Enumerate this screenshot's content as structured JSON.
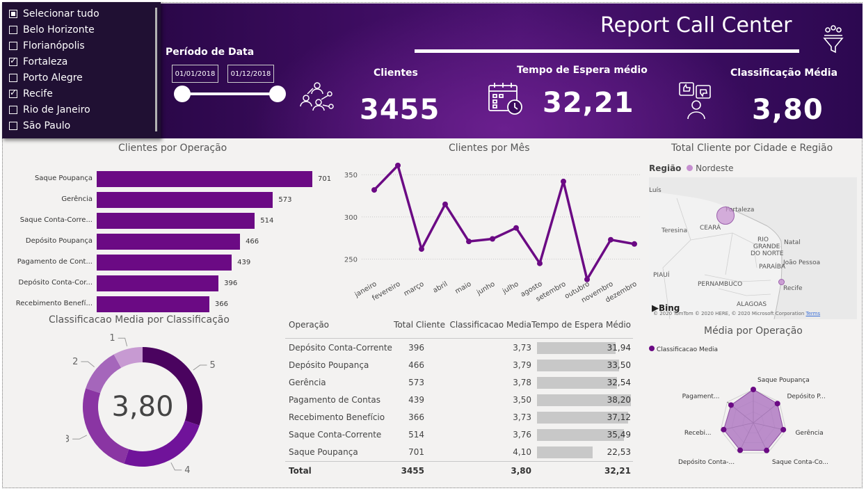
{
  "header": {
    "title": "Report Call Center",
    "periodo_label": "Período de Data",
    "date_start": "01/01/2018",
    "date_end": "01/12/2018",
    "kpis": [
      {
        "label": "Clientes",
        "value": "3455"
      },
      {
        "label": "Tempo de Espera médio",
        "value": "32,21"
      },
      {
        "label": "Classificação Média",
        "value": "3,80"
      }
    ]
  },
  "slicer": {
    "items": [
      {
        "label": "Selecionar tudo",
        "state": "partial"
      },
      {
        "label": "Belo Horizonte",
        "state": "unchecked"
      },
      {
        "label": "Florianópolis",
        "state": "unchecked"
      },
      {
        "label": "Fortaleza",
        "state": "checked"
      },
      {
        "label": "Porto Alegre",
        "state": "unchecked"
      },
      {
        "label": "Recife",
        "state": "checked"
      },
      {
        "label": "Rio de Janeiro",
        "state": "unchecked"
      },
      {
        "label": "São Paulo",
        "state": "unchecked"
      }
    ]
  },
  "colors": {
    "accent": "#6b0a84",
    "line": "#6b0a84",
    "map_bubble": "#c68fd0",
    "radar_fill": "#b07bc3"
  },
  "chart_data": [
    {
      "type": "bar",
      "title": "Clientes por Operação",
      "categories": [
        "Saque Poupança",
        "Gerência",
        "Saque Conta-Corre...",
        "Depósito Poupança",
        "Pagamento de Cont...",
        "Depósito Conta-Cor...",
        "Recebimento Benefí..."
      ],
      "values": [
        701,
        573,
        514,
        466,
        439,
        396,
        366
      ],
      "xlim": [
        0,
        701
      ]
    },
    {
      "type": "line",
      "title": "Clientes por Mês",
      "categories": [
        "janeiro",
        "fevereiro",
        "março",
        "abril",
        "maio",
        "junho",
        "julho",
        "agosto",
        "setembro",
        "outubro",
        "novembro",
        "dezembro"
      ],
      "values": [
        332,
        361,
        262,
        315,
        271,
        274,
        287,
        245,
        342,
        226,
        273,
        268
      ],
      "ylim": [
        225,
        365
      ],
      "yticks": [
        250,
        300,
        350
      ]
    },
    {
      "type": "pie",
      "title": "Classificacao Media por Classificação",
      "center_label": "3,80",
      "labels": [
        "1",
        "2",
        "3",
        "4",
        "5"
      ],
      "values": [
        8,
        12,
        25,
        25,
        30
      ],
      "colors": [
        "#c79ad2",
        "#a566bb",
        "#8a35a3",
        "#70139a",
        "#4a035f"
      ]
    },
    {
      "type": "table",
      "columns": [
        "Operação",
        "Total Cliente",
        "Classificacao Media",
        "Tempo de Espera Médio"
      ],
      "rows": [
        [
          "Depósito Conta-Corrente",
          "396",
          "3,73",
          "31,94"
        ],
        [
          "Depósito Poupança",
          "466",
          "3,79",
          "33,50"
        ],
        [
          "Gerência",
          "573",
          "3,78",
          "32,54"
        ],
        [
          "Pagamento de Contas",
          "439",
          "3,50",
          "38,20"
        ],
        [
          "Recebimento Benefício",
          "366",
          "3,73",
          "37,12"
        ],
        [
          "Saque Conta-Corrente",
          "514",
          "3,76",
          "35,49"
        ],
        [
          "Saque Poupança",
          "701",
          "4,10",
          "22,53"
        ]
      ],
      "total": [
        "Total",
        "3455",
        "3,80",
        "32,21"
      ],
      "wait_values": [
        31.94,
        33.5,
        32.54,
        38.2,
        37.12,
        35.49,
        22.53
      ]
    },
    {
      "type": "radar",
      "title": "Média por Operação",
      "legend": "Classificacao Media",
      "categories": [
        "Saque Poupança",
        "Depósito P...",
        "Gerência",
        "Saque Conta-Co...",
        "Depósito Conta-...",
        "Recebi...",
        "Pagament..."
      ],
      "values": [
        4.1,
        3.79,
        3.78,
        3.76,
        3.73,
        3.73,
        3.5
      ],
      "rmax": 4.1
    }
  ],
  "map": {
    "title": "Total Cliente por Cidade e Região",
    "legend_title": "Região",
    "legend_item": "Nordeste",
    "labels": [
      "Luís",
      "Fortaleza",
      "Teresina",
      "CEARÁ",
      "RIO",
      "GRANDE",
      "DO NORTE",
      "Natal",
      "PARAÍBA",
      "João Pessoa",
      "PIAUÍ",
      "PERNAMBUCO",
      "Recife",
      "ALAGOAS"
    ],
    "bing": "Bing",
    "copyright": "© 2020 TomTom © 2020 HERE, © 2020 Microsoft Corporation",
    "terms": "Terms"
  }
}
